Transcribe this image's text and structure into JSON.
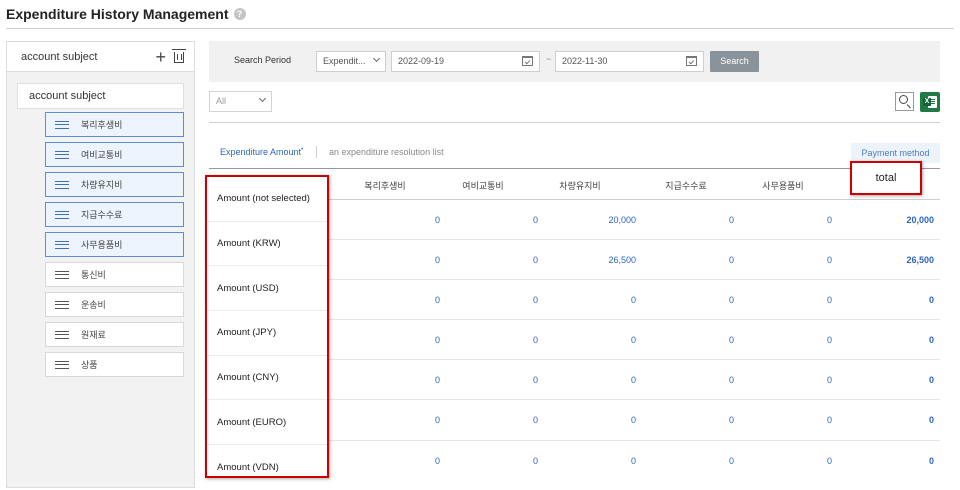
{
  "page": {
    "title": "Expenditure History Management",
    "help_icon": "help-icon"
  },
  "left_panel": {
    "header_label": "account subject",
    "root_label": "account subject",
    "items": [
      {
        "label": "복리후생비",
        "selected": true
      },
      {
        "label": "여비교통비",
        "selected": true
      },
      {
        "label": "차량유지비",
        "selected": true
      },
      {
        "label": "지급수수료",
        "selected": true
      },
      {
        "label": "사무용품비",
        "selected": true
      },
      {
        "label": "통신비",
        "selected": false
      },
      {
        "label": "운송비",
        "selected": false
      },
      {
        "label": "원재료",
        "selected": false
      },
      {
        "label": "상품",
        "selected": false
      }
    ]
  },
  "search": {
    "period_label": "Search Period",
    "period_type": "Expendit...",
    "start_date": "2022-09-19",
    "tilde": "~",
    "end_date": "2022-11-30",
    "button_label": "Search"
  },
  "filter": {
    "value": "All"
  },
  "tabs": {
    "active": "Expenditure Amount",
    "active_mark": "•",
    "inactive": "an expenditure resolution list"
  },
  "payment_method_label": "Payment method",
  "table": {
    "headers": [
      "복리후생비",
      "여비교통비",
      "차량유지비",
      "지급수수료",
      "사무용품비"
    ],
    "rows": [
      [
        "0",
        "0",
        "20,000",
        "0",
        "0",
        "20,000"
      ],
      [
        "0",
        "0",
        "26,500",
        "0",
        "0",
        "26,500"
      ],
      [
        "0",
        "0",
        "0",
        "0",
        "0",
        "0"
      ],
      [
        "0",
        "0",
        "0",
        "0",
        "0",
        "0"
      ],
      [
        "0",
        "0",
        "0",
        "0",
        "0",
        "0"
      ],
      [
        "0",
        "0",
        "0",
        "0",
        "0",
        "0"
      ],
      [
        "0",
        "0",
        "0",
        "0",
        "0",
        "0"
      ]
    ]
  },
  "amount_dropdown": {
    "options": [
      "Amount (not selected)",
      "Amount (KRW)",
      "Amount (USD)",
      "Amount (JPY)",
      "Amount (CNY)",
      "Amount (EURO)",
      "Amount (VDN)"
    ]
  },
  "total_callout": "total",
  "colors": {
    "accent": "#2c64c0",
    "highlight": "#cc0000",
    "excel": "#1f7a46"
  }
}
